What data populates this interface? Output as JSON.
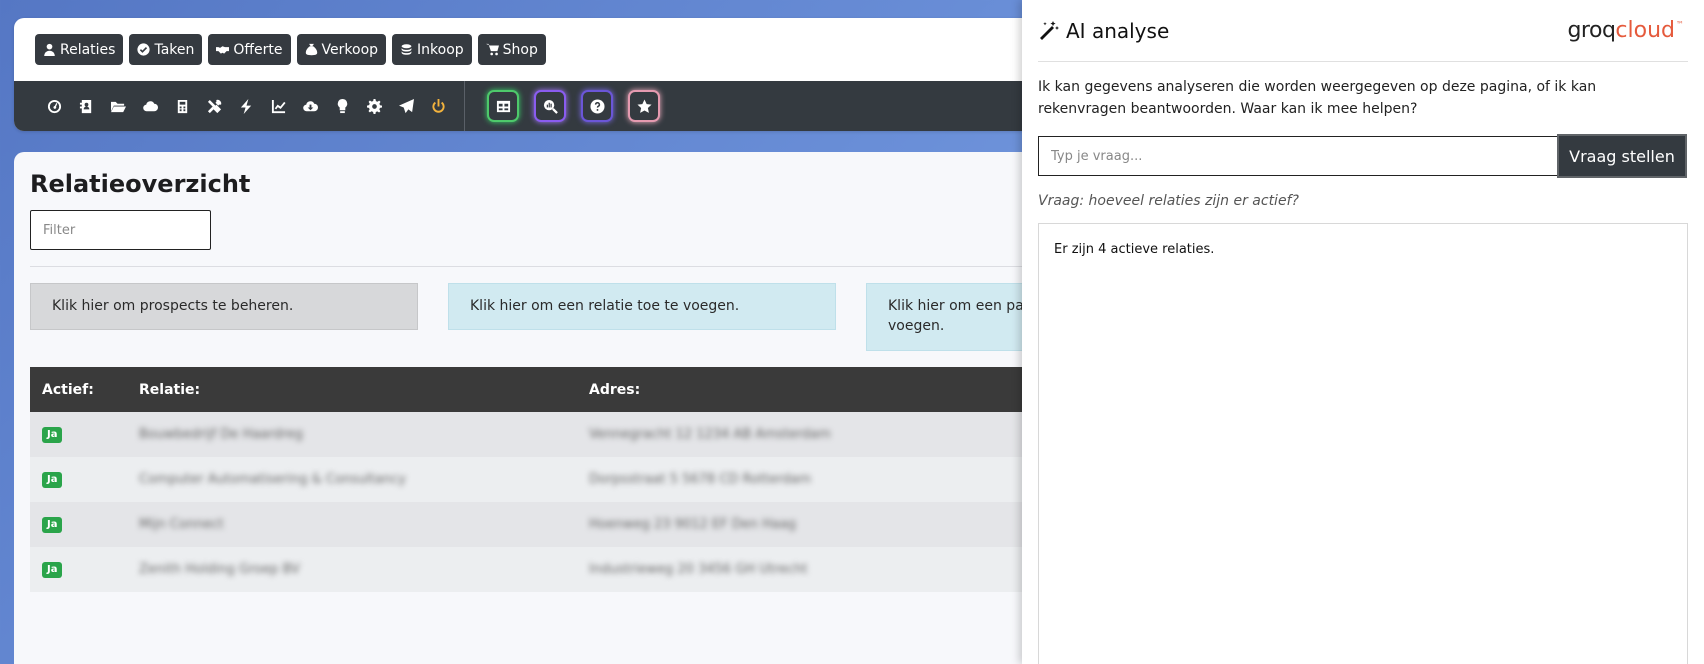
{
  "nav": {
    "buttons": [
      {
        "label": "Relaties",
        "icon": "user-icon"
      },
      {
        "label": "Taken",
        "icon": "check-circle-icon"
      },
      {
        "label": "Offerte",
        "icon": "handshake-icon"
      },
      {
        "label": "Verkoop",
        "icon": "money-bag-icon"
      },
      {
        "label": "Inkoop",
        "icon": "coins-icon"
      },
      {
        "label": "Shop",
        "icon": "cart-icon"
      }
    ]
  },
  "toolbar": {
    "icons": [
      "dashboard-icon",
      "address-book-icon",
      "folder-open-icon",
      "cloud-icon",
      "calculator-icon",
      "tools-icon",
      "bolt-icon",
      "chart-line-icon",
      "cloud-download-icon",
      "lightbulb-icon",
      "gear-icon",
      "paper-plane-icon",
      "power-icon"
    ],
    "glow_buttons": [
      "table-icon",
      "search-chart-icon",
      "help-icon",
      "star-icon"
    ]
  },
  "main": {
    "title": "Relatieoverzicht",
    "filter_placeholder": "Filter",
    "actions": {
      "prospects": "Klik hier om prospects te beheren.",
      "add_relation": "Klik hier om een relatie toe te voegen.",
      "add_other": "Klik hier om een pa voegen."
    },
    "table": {
      "headers": {
        "active": "Actief:",
        "relation": "Relatie:",
        "address": "Adres:"
      },
      "rows": [
        {
          "active": "Ja",
          "relation": "Bouwbedrijf De Haardreg",
          "address": "Vennegracht 12 1234 AB Amsterdam"
        },
        {
          "active": "Ja",
          "relation": "Computer Automatisering & Consultancy",
          "address": "Dorpsstraat 5 5678 CD Rotterdam"
        },
        {
          "active": "Ja",
          "relation": "Mijn Connect",
          "address": "Hoenweg 23 9012 EF Den Haag"
        },
        {
          "active": "Ja",
          "relation": "Zenith Holding Groep BV",
          "address": "Industrieweg 20 3456 GH Utrecht"
        }
      ]
    }
  },
  "ai": {
    "title": "AI analyse",
    "logo": {
      "part1": "groq",
      "part2": "cloud",
      "tm": "™"
    },
    "intro": "Ik kan gegevens analyseren die worden weergegeven op deze pagina, of ik kan rekenvragen beantwoorden. Waar kan ik mee helpen?",
    "input_placeholder": "Typ je vraag...",
    "ask_label": "Vraag stellen",
    "question": "Vraag: hoeveel relaties zijn er actief?",
    "answer": "Er zijn 4 actieve relaties."
  }
}
